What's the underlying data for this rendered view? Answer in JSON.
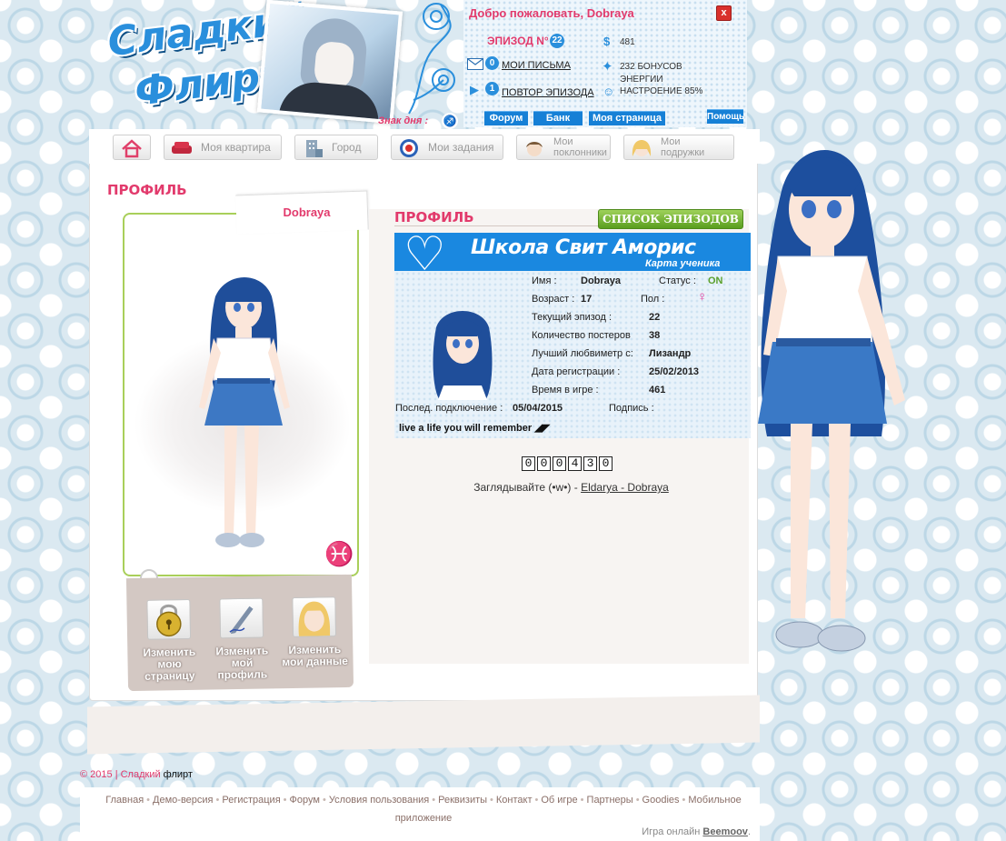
{
  "header": {
    "logo_line1": "Сладкий",
    "logo_line2": "Флирт",
    "sign_label": "Знак дня :",
    "sign_symbol": "♐",
    "welcome": "Добро пожаловать, Dobraya",
    "close_symbol": "x",
    "episode_label": "ЭПИЗОД N°",
    "episode_number": "22",
    "money_symbol": "$",
    "money_value": "481",
    "letters_count": "0",
    "letters_label": "МОИ ПИСЬМА",
    "energy_text": "232 БОНУСОВ ЭНЕРГИИ",
    "replay_count": "1",
    "replay_label": "ПОВТОР ЭПИЗОДА",
    "mood_text": "НАСТРОЕНИЕ 85%",
    "buttons": {
      "forum": "Форум",
      "bank": "Банк",
      "my_page": "Моя страница",
      "help": "Помощь"
    }
  },
  "nav": {
    "apartment": "Моя квартира",
    "city": "Город",
    "tasks": "Мои задания",
    "admirers_1": "Мои",
    "admirers_2": "поклонники",
    "girlfriends_1": "Мои",
    "girlfriends_2": "подружки"
  },
  "page": {
    "title": "ПРОФИЛЬ",
    "avatar_name": "Dobraya",
    "zodiac_symbol": "♓",
    "actions": [
      {
        "line1": "Изменить",
        "line2": "мою",
        "line3": "страницу"
      },
      {
        "line1": "Изменить",
        "line2": "мой",
        "line3": "профиль"
      },
      {
        "line1": "Изменить",
        "line2": "мои данные",
        "line3": ""
      }
    ]
  },
  "profile": {
    "section_title": "ПРОФИЛЬ",
    "episodes_button": "СПИСОК ЭПИЗОДОВ",
    "card_title": "Школа Свит Аморис",
    "card_subtitle": "Карта ученика",
    "name_label": "Имя :",
    "name_value": "Dobraya",
    "status_label": "Статус :",
    "status_value": "ON",
    "age_label": "Возраст :",
    "age_value": "17",
    "gender_label": "Пол :",
    "gender_symbol": "♀",
    "episode_label": "Текущий эпизод :",
    "episode_value": "22",
    "posters_label": "Количество постеров",
    "posters_value": "38",
    "best_label": "Лучший любвиметр с:",
    "best_value": "Лизандр",
    "reg_label": "Дата регистрации :",
    "reg_value": "25/02/2013",
    "time_label": "Время в игре :",
    "time_value": "461",
    "last_conn_label": "Послед. подключение :",
    "last_conn_value": "05/04/2015",
    "signature_label": "Подпись :",
    "motto": "live a life you will remember ◢◤",
    "counter_digits": [
      "0",
      "0",
      "0",
      "4",
      "3",
      "0"
    ],
    "welcome_text": "Заглядывайте (•w•) - ",
    "welcome_link": "Eldarya - Dobraya"
  },
  "footer": {
    "copyright_prefix": "© 2015 | Сладкий",
    "copyright_suffix": " флирт",
    "links": [
      "Главная",
      "Демо-версия",
      "Регистрация",
      "Форум",
      "Условия пользования",
      "Реквизиты",
      "Контакт",
      "Об игре",
      "Партнеры",
      "Goodies",
      "Мобильное приложение"
    ],
    "credit_prefix": "Игра онлайн ",
    "credit_link": "Beemoov",
    "credit_suffix": "."
  },
  "colors": {
    "accent_pink": "#e23a6c",
    "accent_blue": "#1a88e0",
    "accent_green": "#a9cf5a"
  }
}
